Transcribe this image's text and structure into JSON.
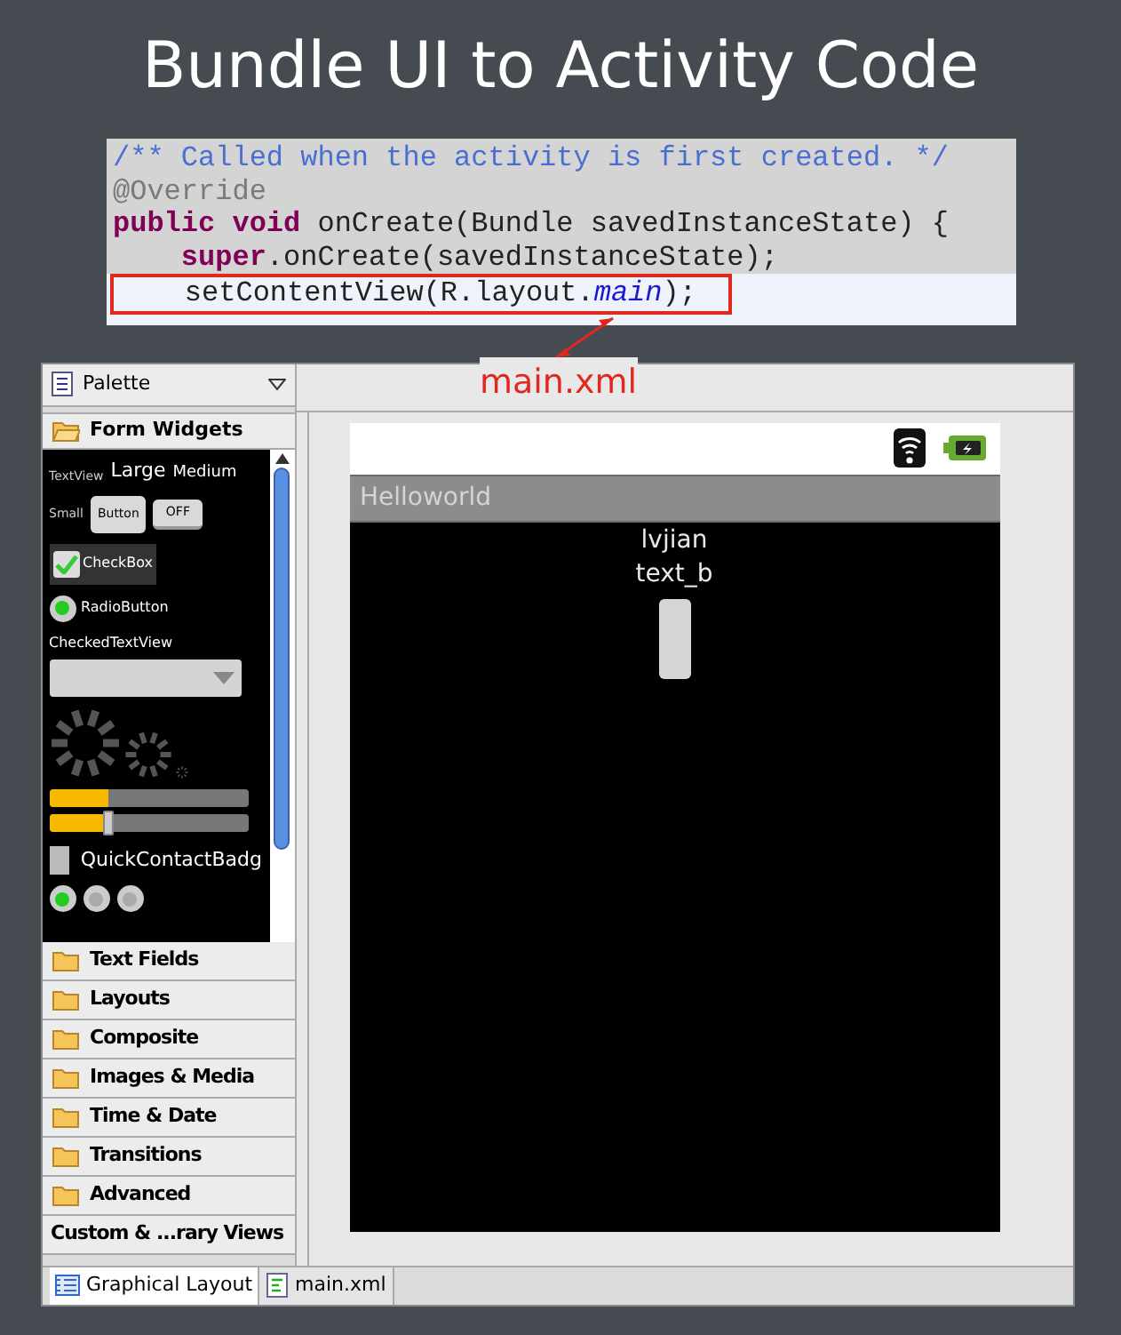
{
  "slide_title": "Bundle UI to Activity Code",
  "code_lines": [
    {
      "highlighted": false,
      "segments": [
        {
          "kind": "comment",
          "text": "/** Called when the activity is first created. */"
        }
      ]
    },
    {
      "highlighted": false,
      "segments": [
        {
          "kind": "annotation",
          "text": "@Override"
        }
      ]
    },
    {
      "highlighted": false,
      "segments": [
        {
          "kind": "keyword",
          "text": "public void"
        },
        {
          "kind": "plain",
          "text": " onCreate(Bundle savedInstanceState) {"
        }
      ]
    },
    {
      "highlighted": false,
      "indented": true,
      "segments": [
        {
          "kind": "keyword",
          "text": "super"
        },
        {
          "kind": "plain",
          "text": ".onCreate(savedInstanceState);"
        }
      ]
    },
    {
      "highlighted": true,
      "indented": true,
      "segments": [
        {
          "kind": "plain",
          "text": "setContentView(R.layout."
        },
        {
          "kind": "field",
          "text": "main"
        },
        {
          "kind": "plain",
          "text": ");"
        }
      ]
    }
  ],
  "callout": {
    "label": "main.xml"
  },
  "palette": {
    "title": "Palette",
    "open_group": "Form Widgets",
    "widgets": {
      "textview": "TextView",
      "large": "Large",
      "medium": "Medium",
      "small": "Small",
      "button": "Button",
      "toggle": "OFF",
      "checkbox": {
        "label": "CheckBox",
        "checked": true
      },
      "radio": {
        "label": "RadioButton",
        "selected": true
      },
      "checked_text": "CheckedTextView",
      "progress": {
        "level": 0.3
      },
      "seekbar": {
        "level": 0.3
      },
      "badge": "QuickContactBadg",
      "radio_group": [
        {
          "selected": true
        },
        {
          "selected": false
        },
        {
          "selected": false
        }
      ]
    },
    "groups": [
      {
        "kind": "folder",
        "label": "Text Fields"
      },
      {
        "kind": "folder",
        "label": "Layouts"
      },
      {
        "kind": "folder",
        "label": "Composite"
      },
      {
        "kind": "folder",
        "label": "Images & Media"
      },
      {
        "kind": "folder",
        "label": "Time & Date"
      },
      {
        "kind": "folder",
        "label": "Transitions"
      },
      {
        "kind": "folder",
        "label": "Advanced"
      },
      {
        "kind": "plain",
        "label": "Custom & ...rary Views"
      }
    ]
  },
  "device": {
    "app_title": "Helloworld",
    "texts": [
      "lvjian",
      "text_b"
    ]
  },
  "editor_tabs": [
    {
      "label": "Graphical Layout",
      "selected": true,
      "kind": "layout"
    },
    {
      "label": "main.xml",
      "selected": false,
      "kind": "xml"
    }
  ]
}
